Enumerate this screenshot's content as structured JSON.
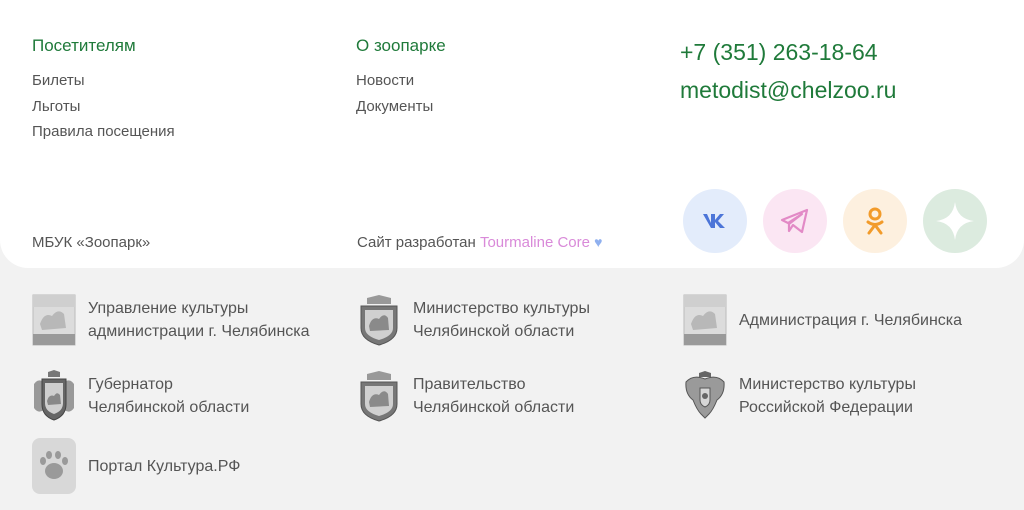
{
  "visitors": {
    "title": "Посетителям",
    "links": [
      "Билеты",
      "Льготы",
      "Правила посещения"
    ]
  },
  "about": {
    "title": "О зоопарке",
    "links": [
      "Новости",
      "Документы"
    ]
  },
  "contacts": {
    "phone": "+7 (351) 263-18-64",
    "email": "metodist@chelzoo.ru"
  },
  "org_name": "МБУК «Зоопарк»",
  "developer": {
    "prefix": "Сайт разработан ",
    "brand": "Tourmaline Core",
    "heart": "♥"
  },
  "social": [
    {
      "icon": "vk-icon",
      "bg": "#e3ecfb",
      "fg": "#4c75d8"
    },
    {
      "icon": "telegram-icon",
      "bg": "#fbe6f3",
      "fg": "#e28ac6"
    },
    {
      "icon": "odnoklassniki-icon",
      "bg": "#fdf0df",
      "fg": "#f29b2a"
    },
    {
      "icon": "dzen-icon",
      "bg": "#dcebdf",
      "fg": "#ffffff"
    }
  ],
  "partners": [
    {
      "line1": "Управление культуры",
      "line2": "администрации г. Челябинска",
      "icon": "chelyabinsk-city-coat-icon"
    },
    {
      "line1": "Министерство культуры",
      "line2": "Челябинской области",
      "icon": "chelyabinsk-region-coat-icon"
    },
    {
      "line1": "Администрация г. Челябинска",
      "line2": "",
      "icon": "chelyabinsk-city-coat-icon"
    },
    {
      "line1": "Губернатор",
      "line2": "Челябинской области",
      "icon": "governor-coat-icon"
    },
    {
      "line1": "Правительство",
      "line2": "Челябинской области",
      "icon": "chelyabinsk-region-coat-icon"
    },
    {
      "line1": "Министерство культуры",
      "line2": "Российской Федерации",
      "icon": "russia-eagle-icon"
    },
    {
      "line1": "Портал Культура.РФ",
      "line2": "",
      "icon": "bear-paw-icon"
    }
  ],
  "colors": {
    "accent": "#1f7a3a",
    "text": "#555555",
    "page_bg": "#f2f2f2",
    "card_bg": "#ffffff",
    "brand": "#d98ad9"
  }
}
